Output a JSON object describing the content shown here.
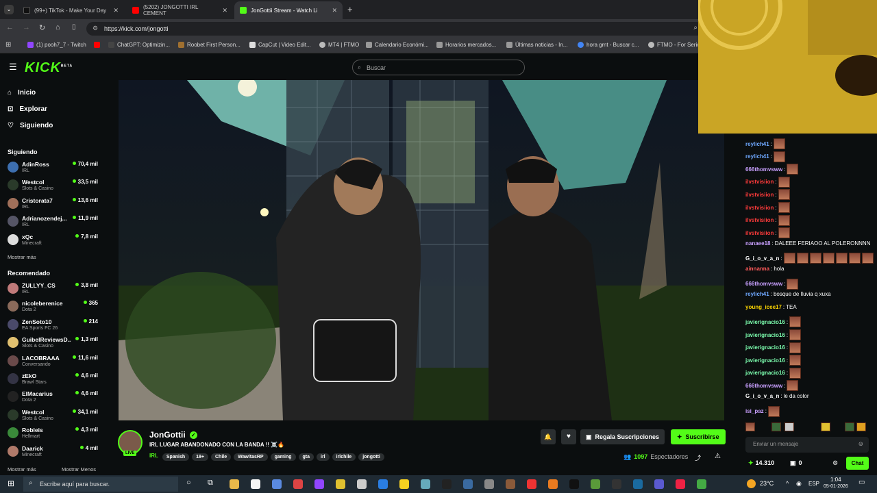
{
  "browser": {
    "tabs": [
      {
        "label": "(99+) TikTok - Make Your Day",
        "color": "#111"
      },
      {
        "label": "(5202) JONGOTTI IRL CEMENT",
        "color": "#ff0000"
      },
      {
        "label": "JonGottii Stream - Watch Li",
        "color": "#53fc18"
      }
    ],
    "url": "https://kick.com/jongotti",
    "bookmarks": [
      "(1) pooh7_7 - Twitch",
      "ChatGPT: Optimizin...",
      "Roobet First Person...",
      "CapCut | Video Edit...",
      "MT4 | FTMO",
      "Calendario Económi...",
      "Horarios mercados...",
      "Últimas noticias - In...",
      "hora gmt - Buscar c...",
      "FTMO - For Serio"
    ]
  },
  "kick": {
    "logo": "KICK",
    "beta": "BETA",
    "search_placeholder": "Buscar"
  },
  "sidebar": {
    "nav": [
      {
        "label": "Inicio",
        "icon": "home-icon"
      },
      {
        "label": "Explorar",
        "icon": "compass-icon"
      },
      {
        "label": "Siguiendo",
        "icon": "heart-icon"
      }
    ],
    "following_title": "Siguiendo",
    "following": [
      {
        "name": "AdinRoss",
        "cat": "IRL",
        "viewers": "70,4 mil",
        "color": "#3d6fb0"
      },
      {
        "name": "Westcol",
        "cat": "Slots & Casino",
        "viewers": "33,5 mil",
        "color": "#2a3a2a"
      },
      {
        "name": "Cristorata7",
        "cat": "IRL",
        "viewers": "13,6 mil",
        "color": "#a0705a"
      },
      {
        "name": "Adrianozendej...",
        "cat": "IRL",
        "viewers": "11,9 mil",
        "color": "#556"
      },
      {
        "name": "xQc",
        "cat": "Minecraft",
        "viewers": "7,8 mil",
        "color": "#ddd"
      }
    ],
    "more1": "Mostrar más",
    "recommended_title": "Recomendado",
    "recommended": [
      {
        "name": "ZULLYY_CS",
        "cat": "IRL",
        "viewers": "3,8 mil",
        "color": "#c07a7a"
      },
      {
        "name": "nicoleberenice",
        "cat": "Dota 2",
        "viewers": "365",
        "color": "#8a6a5a"
      },
      {
        "name": "ZenSoto10",
        "cat": "EA Sports FC 26",
        "viewers": "214",
        "color": "#4a4a6a"
      },
      {
        "name": "GuibelReviewsD...",
        "cat": "Slots & Casino",
        "viewers": "1,3 mil",
        "color": "#e0c070"
      },
      {
        "name": "LACOBRAAA",
        "cat": "Conversando",
        "viewers": "11,6 mil",
        "color": "#6a4a4a"
      },
      {
        "name": "zEkO",
        "cat": "Brawl Stars",
        "viewers": "4,6 mil",
        "color": "#334"
      },
      {
        "name": "ElMacarius",
        "cat": "Dota 2",
        "viewers": "4,6 mil",
        "color": "#222"
      },
      {
        "name": "Westcol",
        "cat": "Slots & Casino",
        "viewers": "34,1 mil",
        "color": "#2a3a2a"
      },
      {
        "name": "Robleis",
        "cat": "Hellmart",
        "viewers": "4,3 mil",
        "color": "#3a8a3a"
      },
      {
        "name": "Daarick",
        "cat": "Minecraft",
        "viewers": "4 mil",
        "color": "#b07a6a"
      }
    ],
    "more2": "Mostrar más",
    "less": "Mostrar Menos"
  },
  "stream": {
    "streamer": "JonGottii",
    "title": "IRL LUGAR ABANDONADO CON LA BANDA !! ☠️🔥",
    "live": "LIVE",
    "category": "IRL",
    "tags": [
      "Spanish",
      "18+",
      "Chile",
      "WawitasRP",
      "gaming",
      "gta",
      "irl",
      "irlchile",
      "jongotti"
    ],
    "gift_label": "Regala Suscripciones",
    "subscribe_label": "Suscribirse",
    "viewers": "1097",
    "viewers_label": "Espectadores"
  },
  "chat": {
    "messages": [
      {
        "user": "reylich41",
        "color": "#6fa8ff",
        "text": "",
        "emotes": 1
      },
      {
        "user": "reylich41",
        "color": "#6fa8ff",
        "text": "",
        "emotes": 1
      },
      {
        "user": "666thomvsww",
        "color": "#c9a0ff",
        "text": "",
        "emotes": 1
      },
      {
        "user": "ilvstvisiion",
        "color": "#ff3b3b",
        "text": "",
        "emotes": 1
      },
      {
        "user": "ilvstvisiion",
        "color": "#ff3b3b",
        "text": "",
        "emotes": 1
      },
      {
        "user": "ilvstvisiion",
        "color": "#ff3b3b",
        "text": "",
        "emotes": 1
      },
      {
        "user": "ilvstvisiion",
        "color": "#ff3b3b",
        "text": "",
        "emotes": 1
      },
      {
        "user": "ilvstvisiion",
        "color": "#ff3b3b",
        "text": "",
        "emotes": 1
      },
      {
        "user": "nanaee18",
        "color": "#c9a0ff",
        "text": "DALEEE FERIAOO AL POLERONNNN",
        "emotes": 0
      },
      {
        "user": "G_i_o_v_a_n",
        "color": "#ffffff",
        "text": "",
        "emotes": 7
      },
      {
        "user": "ainnanna",
        "color": "#ff5a5a",
        "text": "hola",
        "emotes": 0
      },
      {
        "user": "666thomvsww",
        "color": "#c9a0ff",
        "text": "",
        "emotes": 1
      },
      {
        "user": "reylich41",
        "color": "#6fa8ff",
        "text": "bosque de lluvia q xuxa",
        "emotes": 0
      },
      {
        "user": "young_icee17",
        "color": "#ffd700",
        "text": "TEA",
        "emotes": 0
      },
      {
        "user": "javierignacio16",
        "color": "#7dffb0",
        "text": "",
        "emotes": 1
      },
      {
        "user": "javierignacio16",
        "color": "#7dffb0",
        "text": "",
        "emotes": 1
      },
      {
        "user": "javierignacio16",
        "color": "#7dffb0",
        "text": "",
        "emotes": 1
      },
      {
        "user": "javierignacio16",
        "color": "#7dffb0",
        "text": "",
        "emotes": 1
      },
      {
        "user": "javierignacio16",
        "color": "#7dffb0",
        "text": "",
        "emotes": 1
      },
      {
        "user": "666thomvsww",
        "color": "#c9a0ff",
        "text": "",
        "emotes": 1
      },
      {
        "user": "G_i_o_v_a_n",
        "color": "#ffffff",
        "text": "le da color",
        "emotes": 0
      },
      {
        "user": "isi_paz",
        "color": "#c9a0ff",
        "text": "",
        "emotes": 1
      }
    ],
    "input_placeholder": "Enviar un mensaje",
    "points": "14.310",
    "gifts": "0",
    "chat_button": "Chat"
  },
  "taskbar": {
    "search_placeholder": "Escribe aquí para buscar.",
    "weather": "23°C",
    "lang": "ESP",
    "time": "1:04",
    "date": "05-01-2026"
  }
}
